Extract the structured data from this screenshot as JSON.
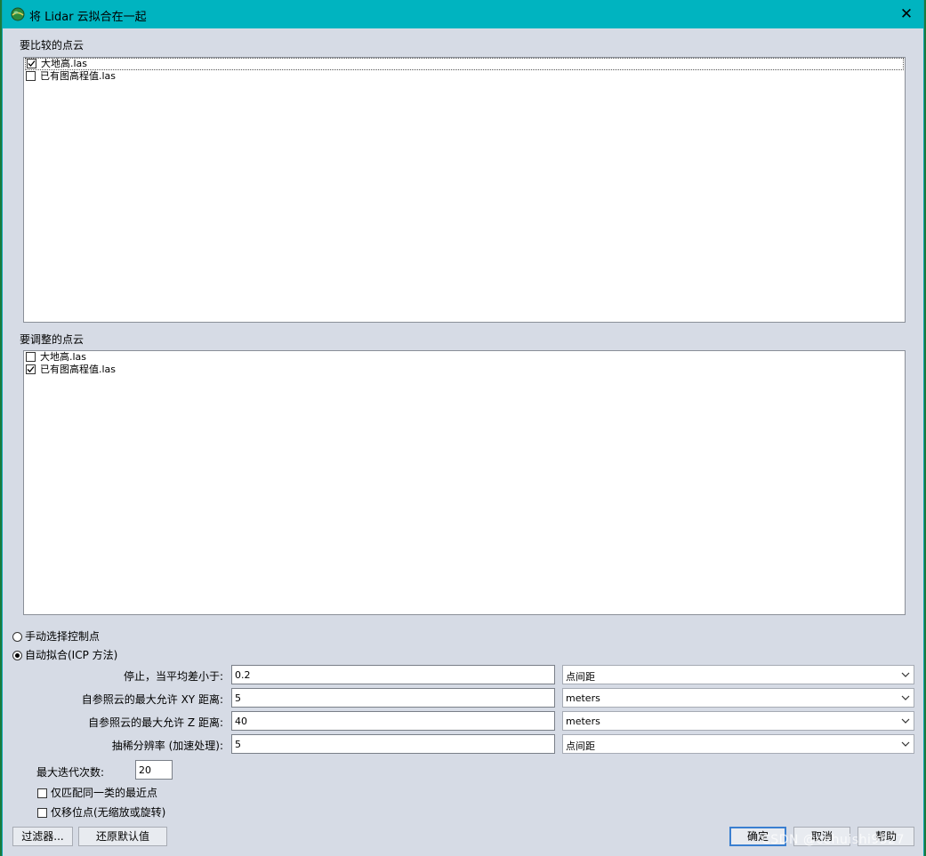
{
  "window": {
    "title": "将 Lidar 云拟合在一起",
    "colors": {
      "titlebar": "#00b4c0",
      "dialog_bg": "#d6dbe5",
      "default_button_border": "#3a7fd0"
    }
  },
  "compare_list": {
    "label": "要比较的点云",
    "items": [
      {
        "label": "大地高.las",
        "checked": true
      },
      {
        "label": "已有图高程值.las",
        "checked": false
      }
    ]
  },
  "adjust_list": {
    "label": "要调整的点云",
    "items": [
      {
        "label": "大地高.las",
        "checked": false
      },
      {
        "label": "已有图高程值.las",
        "checked": true
      }
    ]
  },
  "mode": {
    "manual_label": "手动选择控制点",
    "auto_label": "自动拟合(ICP 方法)",
    "selected": "auto"
  },
  "params": [
    {
      "label": "停止，当平均差小于:",
      "value": "0.2",
      "unit": "点间距"
    },
    {
      "label": "自参照云的最大允许 XY 距离:",
      "value": "5",
      "unit": "meters"
    },
    {
      "label": "自参照云的最大允许 Z 距离:",
      "value": "40",
      "unit": "meters"
    },
    {
      "label": "抽稀分辨率 (加速处理):",
      "value": "5",
      "unit": "点间距"
    }
  ],
  "max_iterations": {
    "label": "最大迭代次数:",
    "value": "20"
  },
  "options": [
    {
      "label": "仅匹配同一类的最近点",
      "checked": false
    },
    {
      "label": "仅移位点(无缩放或旋转)",
      "checked": false
    }
  ],
  "buttons": {
    "filter": "过滤器...",
    "restore_defaults": "还原默认值",
    "ok": "确定",
    "cancel": "取消",
    "help": "帮助"
  },
  "watermark": "CSDN @cehuishi9527"
}
